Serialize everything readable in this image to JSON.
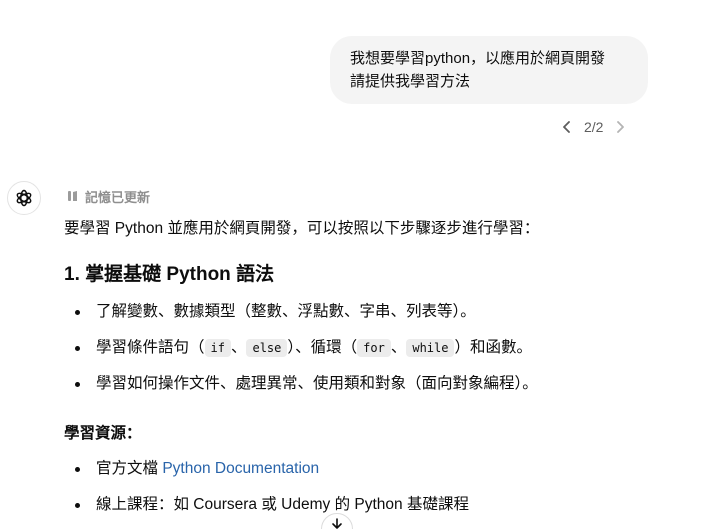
{
  "user_message": {
    "line1": "我想要學習python，以應用於網頁開發",
    "line2": "請提供我學習方法"
  },
  "pager": {
    "count": "2/2"
  },
  "response": {
    "memory_label": "記憶已更新",
    "intro": "要學習 Python 並應用於網頁開發，可以按照以下步驟逐步進行學習：",
    "section1_title": "1. 掌握基礎 Python 語法",
    "bullets1": {
      "b1": "了解變數、數據類型（整數、浮點數、字串、列表等）。",
      "b2_pre": "學習條件語句（",
      "b2_code1": "if",
      "b2_sep1": "、",
      "b2_code2": "else",
      "b2_mid": "）、循環（",
      "b2_code3": "for",
      "b2_sep2": "、",
      "b2_code4": "while",
      "b2_post": "）和函數。",
      "b3": "學習如何操作文件、處理異常、使用類和對象（面向對象編程）。"
    },
    "resources_title": "學習資源：",
    "bullets2": {
      "r1_pre": "官方文檔 ",
      "r1_link": "Python Documentation",
      "r2": "線上課程：如 Coursera 或 Udemy 的 Python 基礎課程"
    }
  }
}
